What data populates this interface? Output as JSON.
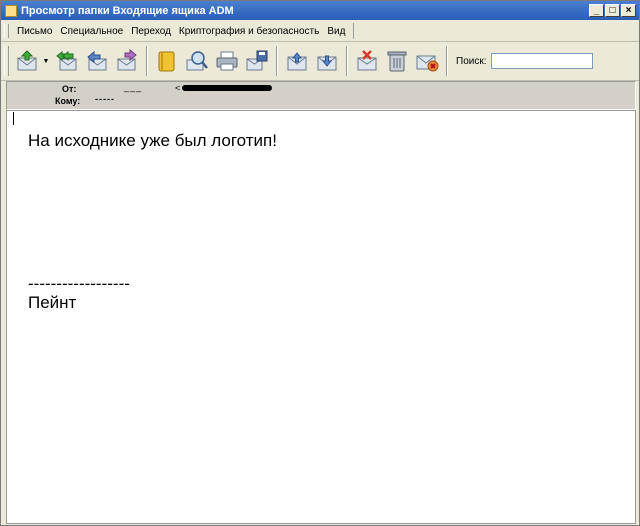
{
  "window": {
    "title": "Просмотр папки Входящие ящика ADM",
    "controls": {
      "minimize": "_",
      "maximize": "□",
      "close": "×"
    }
  },
  "menu": {
    "items": [
      {
        "label": "Письмо"
      },
      {
        "label": "Специальное"
      },
      {
        "label": "Переход"
      },
      {
        "label": "Криптография и безопасность"
      },
      {
        "label": "Вид"
      }
    ]
  },
  "toolbar": {
    "buttons": [
      {
        "icon": "get-mail-icon"
      },
      {
        "icon": "reply-all-icon"
      },
      {
        "icon": "reply-icon"
      },
      {
        "icon": "forward-icon"
      },
      {
        "icon": "address-book-icon"
      },
      {
        "icon": "find-icon"
      },
      {
        "icon": "print-icon"
      },
      {
        "icon": "save-icon"
      },
      {
        "icon": "previous-message-icon"
      },
      {
        "icon": "next-message-icon"
      },
      {
        "icon": "delete-message-icon"
      },
      {
        "icon": "trash-icon"
      },
      {
        "icon": "mark-spam-icon"
      }
    ],
    "search_label": "Поиск:",
    "search_value": ""
  },
  "header": {
    "from_label": "От:",
    "from_value": "___",
    "from_email_bracket": "<",
    "to_label": "Кому:",
    "to_value": "-----"
  },
  "body": {
    "line1": "На исходнике уже был логотип!",
    "separator": "------------------",
    "signature": "Пейнт"
  }
}
